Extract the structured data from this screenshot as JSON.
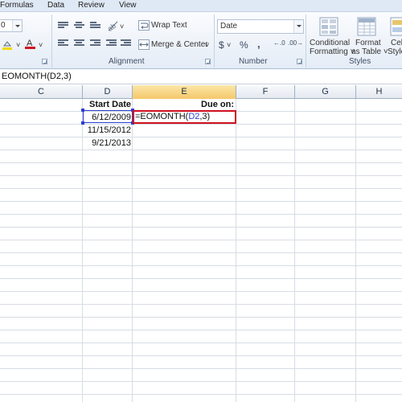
{
  "tabs": [
    "Formulas",
    "Data",
    "Review",
    "View"
  ],
  "ribbon": {
    "wrap_text": "Wrap Text",
    "merge_center": "Merge & Center",
    "number_format": "Date",
    "currency_symbol": "$",
    "percent_symbol": "%",
    "comma_symbol": ",",
    "increase_decimal": "←.0",
    "decrease_decimal": ".00→",
    "conditional_formatting_1": "Conditional",
    "conditional_formatting_2": "Formatting ˅",
    "format_table_1": "Format",
    "format_table_2": "as Table ˅",
    "cell_styles_1": "Cell",
    "cell_styles_2": "Styles",
    "font_size_partial": "0",
    "groups": {
      "alignment": "Alignment",
      "number": "Number",
      "styles": "Styles"
    }
  },
  "formula_bar": {
    "text": "EOMONTH(D2,3)"
  },
  "columns": [
    "C",
    "D",
    "E",
    "F",
    "G",
    "H"
  ],
  "active_column": "E",
  "cells": {
    "D1": "Start Date",
    "E1": "Due on:",
    "D2": "6/12/2009",
    "D3": "11/15/2012",
    "D4": "9/21/2013"
  },
  "edit": {
    "prefix": "=EOMONTH(",
    "ref": "D2",
    "suffix": ",3)"
  },
  "colors": {
    "edit_border": "#d0101e",
    "reference": "#2a3fd0",
    "active_header": "#f5c86a"
  }
}
